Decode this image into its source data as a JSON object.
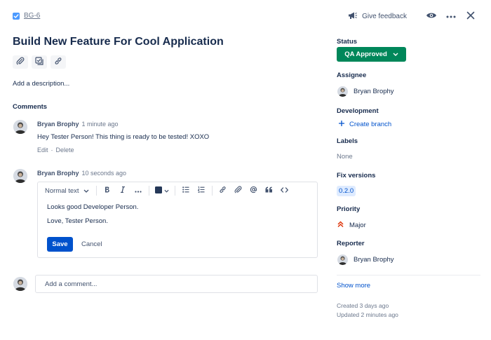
{
  "header": {
    "issue_key": "BG-6",
    "feedback_label": "Give feedback",
    "title": "Build New Feature For Cool Application"
  },
  "description": {
    "placeholder": "Add a description..."
  },
  "comments": {
    "heading": "Comments",
    "items": [
      {
        "author": "Bryan Brophy",
        "time": "1 minute ago",
        "body": "Hey Tester Person! This thing is ready to be tested! XOXO",
        "edit_label": "Edit",
        "separator": "·",
        "delete_label": "Delete"
      }
    ],
    "draft": {
      "author": "Bryan Brophy",
      "time": "10 seconds ago",
      "text_style": "Normal text",
      "lines": [
        "Looks good Developer Person.",
        "Love, Tester Person."
      ],
      "save_label": "Save",
      "cancel_label": "Cancel"
    },
    "add_placeholder": "Add a comment..."
  },
  "sidebar": {
    "status": {
      "label": "Status",
      "value": "QA Approved"
    },
    "assignee": {
      "label": "Assignee",
      "value": "Bryan Brophy"
    },
    "development": {
      "label": "Development",
      "action": "Create branch"
    },
    "labels": {
      "label": "Labels",
      "value": "None"
    },
    "fix_versions": {
      "label": "Fix versions",
      "value": "0.2.0"
    },
    "priority": {
      "label": "Priority",
      "value": "Major"
    },
    "reporter": {
      "label": "Reporter",
      "value": "Bryan Brophy"
    },
    "show_more": "Show more",
    "created": "Created 3 days ago",
    "updated": "Updated 2 minutes ago"
  },
  "colors": {
    "status_green": "#00875a",
    "primary_blue": "#0052cc",
    "priority_red": "#de350b",
    "text": "#172b4d"
  }
}
